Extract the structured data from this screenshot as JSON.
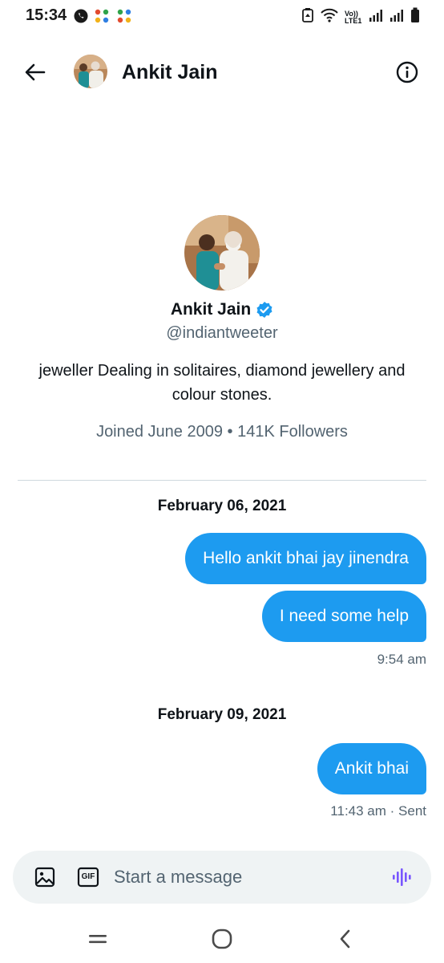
{
  "status_bar": {
    "time": "15:34",
    "network_label": "Vo)) LTE1"
  },
  "header": {
    "title": "Ankit Jain",
    "back_icon": "arrow-left-icon",
    "info_icon": "info-circle-icon"
  },
  "profile": {
    "name": "Ankit Jain",
    "handle": "@indiantweeter",
    "bio": "jeweller Dealing in solitaires, diamond jewellery and colour stones.",
    "meta": "Joined June 2009 • 141K Followers",
    "verified_color": "#1d9bf0"
  },
  "conversation": {
    "groups": [
      {
        "date": "February 06, 2021",
        "messages": [
          "Hello ankit bhai jay jinendra",
          "I need some help"
        ],
        "timestamp": "9:54 am"
      },
      {
        "date": "February 09, 2021",
        "messages": [
          "Ankit bhai"
        ],
        "timestamp": "11:43 am · Sent"
      }
    ]
  },
  "composer": {
    "placeholder": "Start a message",
    "gif_label": "GIF"
  },
  "colors": {
    "accent": "#1d9bf0",
    "secondary_text": "#536471",
    "voice_icon": "#7856ff"
  }
}
